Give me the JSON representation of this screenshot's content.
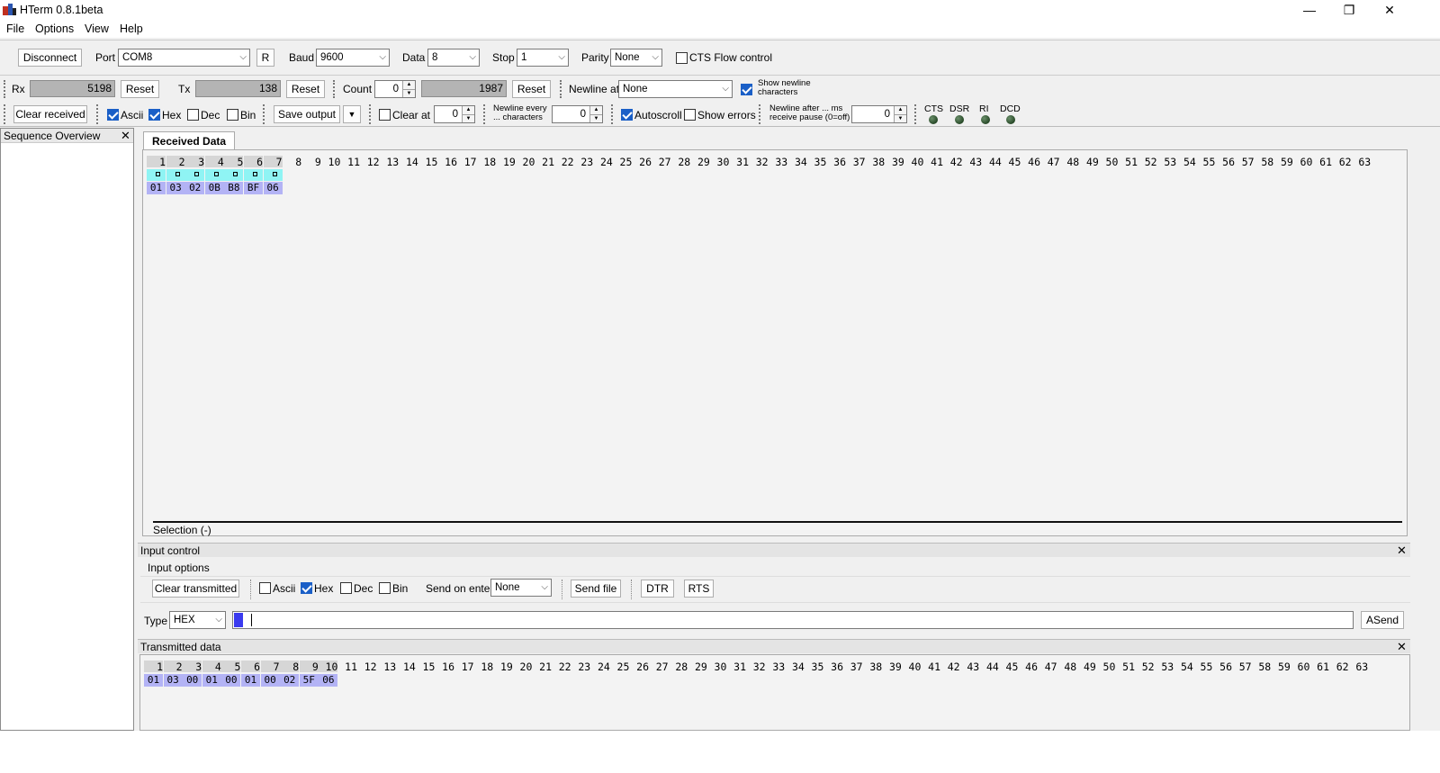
{
  "window": {
    "title": "HTerm 0.8.1beta",
    "minimize": "—",
    "maximize": "❐",
    "close": "✕"
  },
  "menu": [
    "File",
    "Options",
    "View",
    "Help"
  ],
  "connection": {
    "disconnect_label": "Disconnect",
    "port_label": "Port",
    "port_value": "COM8",
    "refresh_label": "R",
    "baud_label": "Baud",
    "baud_value": "9600",
    "data_label": "Data",
    "data_value": "8",
    "stop_label": "Stop",
    "stop_value": "1",
    "parity_label": "Parity",
    "parity_value": "None",
    "cts_label": "CTS Flow control",
    "cts_checked": false
  },
  "counters": {
    "rx_label": "Rx",
    "rx_value": "5198",
    "rx_reset": "Reset",
    "tx_label": "Tx",
    "tx_value": "138",
    "tx_reset": "Reset",
    "count_label": "Count",
    "count_value": "0",
    "count_total": "1987",
    "count_reset": "Reset",
    "newline_at_label": "Newline at",
    "newline_at_value": "None",
    "show_newline_label_1": "Show newline",
    "show_newline_label_2": "characters",
    "show_newline_checked": true
  },
  "display": {
    "clear_received": "Clear received",
    "ascii_label": "Ascii",
    "ascii_checked": true,
    "hex_label": "Hex",
    "hex_checked": true,
    "dec_label": "Dec",
    "dec_checked": false,
    "bin_label": "Bin",
    "bin_checked": false,
    "save_output": "Save output",
    "clear_at_label": "Clear at",
    "clear_at_value": "0",
    "clear_at_checked": false,
    "newline_every_1": "Newline every",
    "newline_every_2": "... characters",
    "newline_every_value": "0",
    "autoscroll_label": "Autoscroll",
    "autoscroll_checked": true,
    "show_errors_label": "Show errors",
    "show_errors_checked": false,
    "newline_after_1": "Newline after ... ms",
    "newline_after_2": "receive pause (0=off)",
    "newline_after_value": "0",
    "signals": [
      "CTS",
      "DSR",
      "RI",
      "DCD"
    ]
  },
  "sequence_overview": {
    "title": "Sequence Overview",
    "close": "✕"
  },
  "received": {
    "tab": "Received Data",
    "columns": 63,
    "highlighted_columns": 7,
    "hex_bytes": [
      "01",
      "03",
      "02",
      "0B",
      "B8",
      "BF",
      "06"
    ],
    "ascii_cells": 7,
    "selection": "Selection (-)"
  },
  "input_control": {
    "title": "Input control",
    "close": "✕",
    "options_label": "Input options",
    "clear_transmitted": "Clear transmitted",
    "ascii_label": "Ascii",
    "ascii_checked": false,
    "hex_label": "Hex",
    "hex_checked": true,
    "dec_label": "Dec",
    "dec_checked": false,
    "bin_label": "Bin",
    "bin_checked": false,
    "send_on_enter_label": "Send on enter",
    "send_on_enter_value": "None",
    "send_file": "Send file",
    "dtr": "DTR",
    "rts": "RTS",
    "type_label": "Type",
    "type_value": "HEX",
    "input_value": "",
    "asend": "ASend"
  },
  "transmitted": {
    "title": "Transmitted data",
    "close": "✕",
    "columns": 63,
    "highlighted_columns": 10,
    "hex_bytes": [
      "01",
      "03",
      "00",
      "01",
      "00",
      "01",
      "00",
      "02",
      "5F",
      "06"
    ]
  }
}
